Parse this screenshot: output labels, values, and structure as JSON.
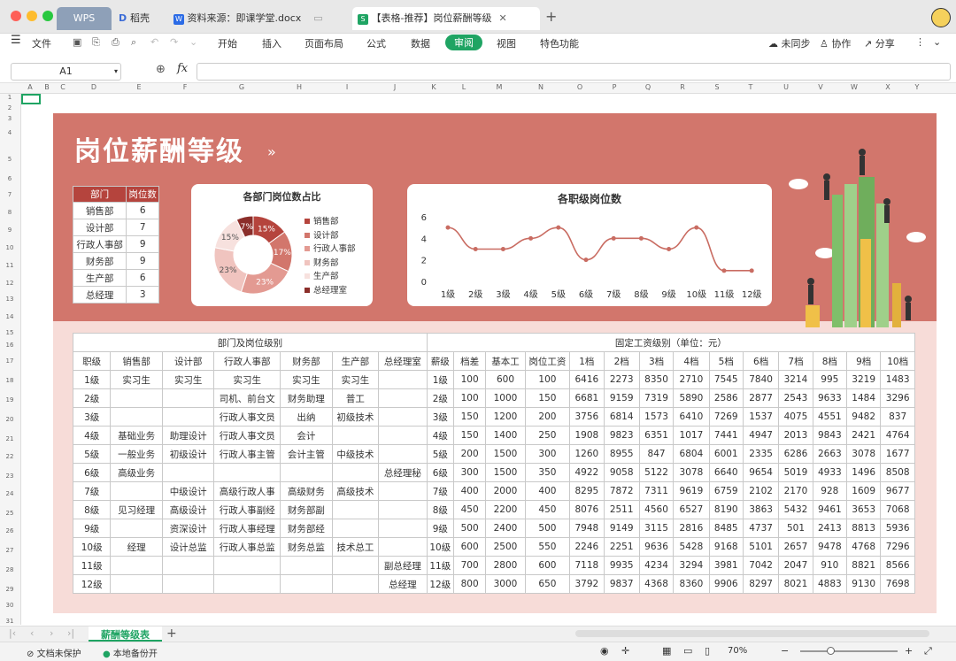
{
  "window": {
    "tabs": [
      {
        "label": "WPS"
      },
      {
        "label": "稻壳"
      },
      {
        "label": "资料来源：即课学堂.docx"
      },
      {
        "label": "【表格-推荐】岗位薪酬等级"
      }
    ]
  },
  "menu": {
    "file": "文件",
    "items": [
      "开始",
      "插入",
      "页面布局",
      "公式",
      "数据",
      "审阅",
      "视图",
      "特色功能"
    ],
    "active": "审阅",
    "sync": "未同步",
    "collab": "协作",
    "share": "分享"
  },
  "formula": {
    "cell_ref": "A1",
    "fx": "fx"
  },
  "columns": [
    "A",
    "B",
    "C",
    "D",
    "E",
    "F",
    "G",
    "H",
    "I",
    "J",
    "K",
    "L",
    "M",
    "N",
    "O",
    "P",
    "Q",
    "R",
    "S",
    "T",
    "U",
    "V",
    "W",
    "X",
    "Y"
  ],
  "rows": [
    "1",
    "2",
    "3",
    "4",
    "5",
    "6",
    "7",
    "8",
    "9",
    "10",
    "11",
    "12",
    "13",
    "14",
    "15",
    "16",
    "17",
    "18",
    "19",
    "20",
    "21",
    "22",
    "23",
    "24",
    "25",
    "26",
    "27",
    "28",
    "29",
    "30",
    "31"
  ],
  "banner": {
    "title": "岗位薪酬等级",
    "chevrons": "»"
  },
  "dept_table": {
    "headers": [
      "部门",
      "岗位数"
    ],
    "rows": [
      [
        "销售部",
        "6"
      ],
      [
        "设计部",
        "7"
      ],
      [
        "行政人事部",
        "9"
      ],
      [
        "财务部",
        "9"
      ],
      [
        "生产部",
        "6"
      ],
      [
        "总经理",
        "3"
      ]
    ]
  },
  "pie": {
    "title": "各部门岗位数占比",
    "legend": [
      "销售部",
      "设计部",
      "行政人事部",
      "财务部",
      "生产部",
      "总经理室"
    ],
    "labels": [
      "15%",
      "17%",
      "23%",
      "23%",
      "15%",
      "7%"
    ]
  },
  "chart_data": [
    {
      "type": "pie",
      "title": "各部门岗位数占比",
      "categories": [
        "销售部",
        "设计部",
        "行政人事部",
        "财务部",
        "生产部",
        "总经理室"
      ],
      "values": [
        15,
        17,
        23,
        23,
        15,
        7
      ],
      "colors": [
        "#b5443d",
        "#d2766c",
        "#e39a92",
        "#f0c4bf",
        "#f7e1de",
        "#8b2e2a"
      ]
    },
    {
      "type": "line",
      "title": "各职级岗位数",
      "categories": [
        "1级",
        "2级",
        "3级",
        "4级",
        "5级",
        "6级",
        "7级",
        "8级",
        "9级",
        "10级",
        "11级",
        "12级"
      ],
      "values": [
        5,
        3,
        3,
        4,
        5,
        2,
        4,
        4,
        3,
        5,
        1,
        1
      ],
      "ylim": [
        0,
        6
      ],
      "yticks": [
        "0",
        "2",
        "4",
        "6"
      ]
    }
  ],
  "line": {
    "title": "各职级岗位数",
    "yticks": [
      "6",
      "4",
      "2",
      "0"
    ],
    "xlabels": [
      "1级",
      "2级",
      "3级",
      "4级",
      "5级",
      "6级",
      "7级",
      "8级",
      "9级",
      "10级",
      "11级",
      "12级"
    ]
  },
  "main_table": {
    "group1": "部门及岗位级别",
    "group2": "固定工资级别（单位：元）",
    "headers": [
      "职级",
      "销售部",
      "设计部",
      "行政人事部",
      "财务部",
      "生产部",
      "总经理室",
      "薪级",
      "档差",
      "基本工",
      "岗位工资",
      "1档",
      "2档",
      "3档",
      "4档",
      "5档",
      "6档",
      "7档",
      "8档",
      "9档",
      "10档"
    ],
    "rows": [
      [
        "1级",
        "实习生",
        "实习生",
        "实习生",
        "实习生",
        "实习生",
        "",
        "1级",
        "100",
        "600",
        "100",
        "6416",
        "2273",
        "8350",
        "2710",
        "7545",
        "7840",
        "3214",
        "995",
        "3219",
        "1483"
      ],
      [
        "2级",
        "",
        "",
        "司机、前台文",
        "财务助理",
        "普工",
        "",
        "2级",
        "100",
        "1000",
        "150",
        "6681",
        "9159",
        "7319",
        "5890",
        "2586",
        "2877",
        "2543",
        "9633",
        "1484",
        "3296"
      ],
      [
        "3级",
        "",
        "",
        "行政人事文员",
        "出纳",
        "初级技术",
        "",
        "3级",
        "150",
        "1200",
        "200",
        "3756",
        "6814",
        "1573",
        "6410",
        "7269",
        "1537",
        "4075",
        "4551",
        "9482",
        "837"
      ],
      [
        "4级",
        "基础业务",
        "助理设计",
        "行政人事文员",
        "会计",
        "",
        "",
        "4级",
        "150",
        "1400",
        "250",
        "1908",
        "9823",
        "6351",
        "1017",
        "7441",
        "4947",
        "2013",
        "9843",
        "2421",
        "4764"
      ],
      [
        "5级",
        "一般业务",
        "初级设计",
        "行政人事主管",
        "会计主管",
        "中级技术",
        "",
        "5级",
        "200",
        "1500",
        "300",
        "1260",
        "8955",
        "847",
        "6804",
        "6001",
        "2335",
        "6286",
        "2663",
        "3078",
        "1677"
      ],
      [
        "6级",
        "高级业务",
        "",
        "",
        "",
        "",
        "总经理秘",
        "6级",
        "300",
        "1500",
        "350",
        "4922",
        "9058",
        "5122",
        "3078",
        "6640",
        "9654",
        "5019",
        "4933",
        "1496",
        "8508"
      ],
      [
        "7级",
        "",
        "中级设计",
        "高级行政人事",
        "高级财务",
        "高级技术",
        "",
        "7级",
        "400",
        "2000",
        "400",
        "8295",
        "7872",
        "7311",
        "9619",
        "6759",
        "2102",
        "2170",
        "928",
        "1609",
        "9677"
      ],
      [
        "8级",
        "见习经理",
        "高级设计",
        "行政人事副经",
        "财务部副",
        "",
        "",
        "8级",
        "450",
        "2200",
        "450",
        "8076",
        "2511",
        "4560",
        "6527",
        "8190",
        "3863",
        "5432",
        "9461",
        "3653",
        "7068"
      ],
      [
        "9级",
        "",
        "资深设计",
        "行政人事经理",
        "财务部经",
        "",
        "",
        "9级",
        "500",
        "2400",
        "500",
        "7948",
        "9149",
        "3115",
        "2816",
        "8485",
        "4737",
        "501",
        "2413",
        "8813",
        "5936"
      ],
      [
        "10级",
        "经理",
        "设计总监",
        "行政人事总监",
        "财务总监",
        "技术总工",
        "",
        "10级",
        "600",
        "2500",
        "550",
        "2246",
        "2251",
        "9636",
        "5428",
        "9168",
        "5101",
        "2657",
        "9478",
        "4768",
        "7296"
      ],
      [
        "11级",
        "",
        "",
        "",
        "",
        "",
        "副总经理",
        "11级",
        "700",
        "2800",
        "600",
        "7118",
        "9935",
        "4234",
        "3294",
        "3981",
        "7042",
        "2047",
        "910",
        "8821",
        "8566"
      ],
      [
        "12级",
        "",
        "",
        "",
        "",
        "",
        "总经理",
        "12级",
        "800",
        "3000",
        "650",
        "3792",
        "9837",
        "4368",
        "8360",
        "9906",
        "8297",
        "8021",
        "4883",
        "9130",
        "7698"
      ]
    ]
  },
  "sheet_tab": "薪酬等级表",
  "status": {
    "protect": "文档未保护",
    "backup": "本地备份开",
    "zoom": "70%"
  }
}
